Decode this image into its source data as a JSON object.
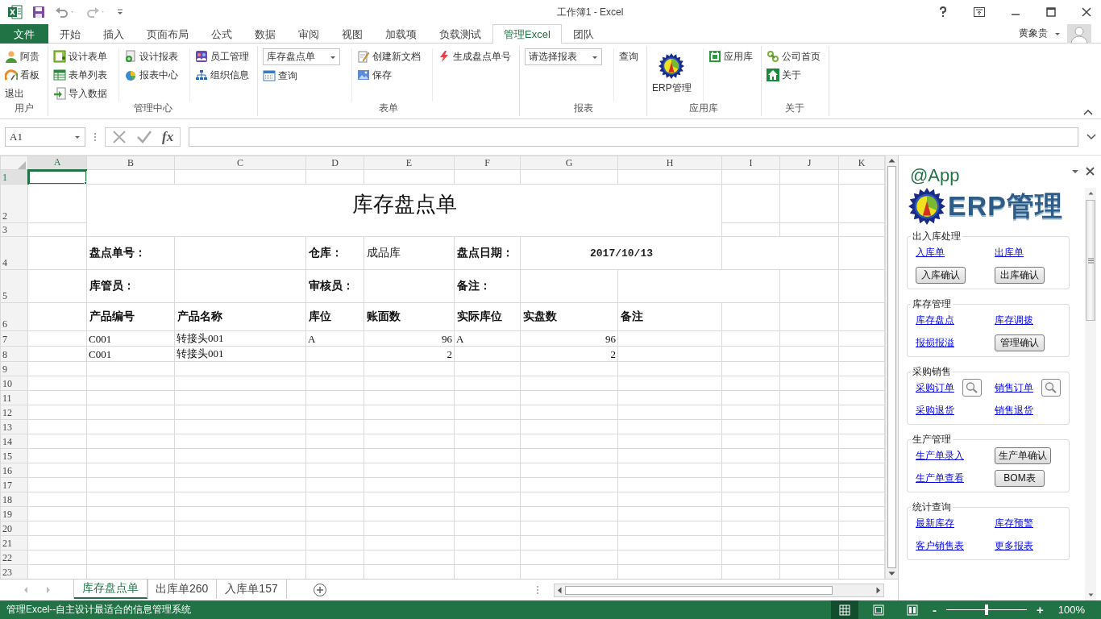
{
  "window": {
    "title": "工作簿1 - Excel"
  },
  "ribbon_tabs": [
    {
      "label": "文件",
      "kind": "file",
      "selected": false
    },
    {
      "label": "开始",
      "kind": "tab",
      "selected": false
    },
    {
      "label": "插入",
      "kind": "tab",
      "selected": false
    },
    {
      "label": "页面布局",
      "kind": "tab",
      "selected": false
    },
    {
      "label": "公式",
      "kind": "tab",
      "selected": false
    },
    {
      "label": "数据",
      "kind": "tab",
      "selected": false
    },
    {
      "label": "审阅",
      "kind": "tab",
      "selected": false
    },
    {
      "label": "视图",
      "kind": "tab",
      "selected": false
    },
    {
      "label": "加载项",
      "kind": "tab",
      "selected": false
    },
    {
      "label": "负载测试",
      "kind": "tab",
      "selected": false
    },
    {
      "label": "管理Excel",
      "kind": "tab",
      "selected": true
    },
    {
      "label": "团队",
      "kind": "tab",
      "selected": false
    }
  ],
  "account": {
    "user": "黄象贵"
  },
  "ribbon_groups": [
    {
      "label": "用户",
      "columns": [
        [
          {
            "kind": "button",
            "label": "阿贵"
          },
          {
            "kind": "button",
            "label": "看板"
          },
          {
            "kind": "text",
            "label": "退出"
          }
        ]
      ]
    },
    {
      "label": "管理中心",
      "columns": [
        [
          {
            "kind": "button",
            "label": "设计表单"
          },
          {
            "kind": "button",
            "label": "表单列表"
          },
          {
            "kind": "button",
            "label": "导入数据"
          }
        ],
        [
          {
            "kind": "button",
            "label": "设计报表"
          },
          {
            "kind": "button",
            "label": "报表中心"
          }
        ],
        [
          {
            "kind": "button",
            "label": "员工管理"
          },
          {
            "kind": "button",
            "label": "组织信息"
          }
        ]
      ]
    },
    {
      "label": "表单",
      "columns": [
        [
          {
            "kind": "dropdown",
            "label": "库存盘点单"
          },
          {
            "kind": "button",
            "label": "查询"
          }
        ],
        [
          {
            "kind": "button",
            "label": "创建新文档"
          },
          {
            "kind": "button",
            "label": "保存"
          }
        ],
        [
          {
            "kind": "button",
            "label": "生成盘点单号"
          }
        ]
      ]
    },
    {
      "label": "报表",
      "columns": [
        [
          {
            "kind": "dropdown",
            "label": "请选择报表"
          }
        ],
        [
          {
            "kind": "text",
            "label": "查询"
          }
        ]
      ]
    },
    {
      "label": "应用库",
      "columns": [
        [
          {
            "kind": "large",
            "label": "ERP管理"
          }
        ],
        [
          {
            "kind": "button",
            "label": "应用库"
          }
        ]
      ]
    },
    {
      "label": "关于",
      "columns": [
        [
          {
            "kind": "button",
            "label": "公司首页"
          },
          {
            "kind": "button",
            "label": "关于"
          }
        ]
      ]
    }
  ],
  "formula_bar": {
    "name_box": "A1",
    "function_label": "fx"
  },
  "sheet": {
    "columns": [
      {
        "label": "A",
        "selected": true
      },
      {
        "label": "B",
        "selected": false
      },
      {
        "label": "C",
        "selected": false
      },
      {
        "label": "D",
        "selected": false
      },
      {
        "label": "E",
        "selected": false
      },
      {
        "label": "F",
        "selected": false
      },
      {
        "label": "G",
        "selected": false
      },
      {
        "label": "H",
        "selected": false
      },
      {
        "label": "I",
        "selected": false
      },
      {
        "label": "J",
        "selected": false
      },
      {
        "label": "K",
        "selected": false
      }
    ],
    "rows": [
      {
        "label": "1",
        "selected": true
      },
      {
        "label": "2",
        "selected": false
      },
      {
        "label": "3",
        "selected": false
      },
      {
        "label": "4",
        "selected": false
      },
      {
        "label": "5",
        "selected": false
      },
      {
        "label": "6",
        "selected": false
      },
      {
        "label": "7",
        "selected": false
      },
      {
        "label": "8",
        "selected": false
      },
      {
        "label": "9",
        "selected": false
      },
      {
        "label": "10",
        "selected": false
      },
      {
        "label": "11",
        "selected": false
      },
      {
        "label": "12",
        "selected": false
      },
      {
        "label": "13",
        "selected": false
      },
      {
        "label": "14",
        "selected": false
      },
      {
        "label": "15",
        "selected": false
      },
      {
        "label": "16",
        "selected": false
      },
      {
        "label": "17",
        "selected": false
      },
      {
        "label": "18",
        "selected": false
      },
      {
        "label": "19",
        "selected": false
      },
      {
        "label": "20",
        "selected": false
      },
      {
        "label": "21",
        "selected": false
      },
      {
        "label": "22",
        "selected": false
      },
      {
        "label": "23",
        "selected": false
      }
    ],
    "form": {
      "title": "库存盘点单",
      "fields": [
        {
          "label": "盘点单号："
        },
        {
          "label": "仓库：",
          "value": "成品库"
        },
        {
          "label": "盘点日期：",
          "value": "2017/10/13"
        },
        {
          "label": "库管员："
        },
        {
          "label": "审核员："
        },
        {
          "label": "备注："
        }
      ],
      "headers": [
        "产品编号",
        "产品名称",
        "库位",
        "账面数",
        "实际库位",
        "实盘数",
        "备注"
      ],
      "lines": [
        {
          "product_code": "C001",
          "product_name": "转接头001",
          "location": "A",
          "book_qty": "96",
          "actual_location": "A",
          "counted_qty": "96"
        },
        {
          "product_code": "C001",
          "product_name": "转接头001",
          "book_qty": "2",
          "counted_qty": "2"
        }
      ]
    }
  },
  "sheet_tabs": [
    {
      "label": "库存盘点单",
      "selected": true
    },
    {
      "label": "出库单260",
      "selected": false
    },
    {
      "label": "入库单157",
      "selected": false
    }
  ],
  "task_pane": {
    "title": "@App",
    "logo_text": "ERP管理",
    "sections": [
      {
        "title": "出入库处理",
        "rows": [
          [
            {
              "kind": "link",
              "label": "入库单"
            },
            {
              "kind": "link",
              "label": "出库单"
            }
          ],
          [
            {
              "kind": "button",
              "label": "入库确认"
            },
            {
              "kind": "button",
              "label": "出库确认"
            }
          ]
        ]
      },
      {
        "title": "库存管理",
        "rows": [
          [
            {
              "kind": "link",
              "label": "库存盘点"
            },
            {
              "kind": "link",
              "label": "库存调拨"
            }
          ],
          [
            {
              "kind": "link",
              "label": "报损报溢"
            },
            {
              "kind": "button",
              "label": "管理确认"
            }
          ]
        ]
      },
      {
        "title": "采购销售",
        "rows": [
          [
            {
              "kind": "link_search",
              "label": "采购订单"
            },
            {
              "kind": "link_search",
              "label": "销售订单"
            }
          ],
          [
            {
              "kind": "link",
              "label": "采购退货"
            },
            {
              "kind": "link",
              "label": "销售退货"
            }
          ]
        ]
      },
      {
        "title": "生产管理",
        "rows": [
          [
            {
              "kind": "link",
              "label": "生产单录入"
            },
            {
              "kind": "button",
              "label": "生产单确认"
            }
          ],
          [
            {
              "kind": "link",
              "label": "生产单查看"
            },
            {
              "kind": "button",
              "label": "BOM表"
            }
          ]
        ]
      },
      {
        "title": "统计查询",
        "rows": [
          [
            {
              "kind": "link",
              "label": "最新库存"
            },
            {
              "kind": "link",
              "label": "库存预警"
            }
          ],
          [
            {
              "kind": "link",
              "label": "客户销售表"
            },
            {
              "kind": "link",
              "label": "更多报表"
            }
          ]
        ]
      }
    ]
  },
  "status_bar": {
    "text": "管理Excel--自主设计最适合的信息管理系统",
    "views": [
      {
        "selected": true
      },
      {
        "selected": false
      },
      {
        "selected": false
      }
    ],
    "zoom_out": "-",
    "zoom_in": "+",
    "zoom": {
      "level": 0.5
    },
    "zoom_label": "100%"
  }
}
